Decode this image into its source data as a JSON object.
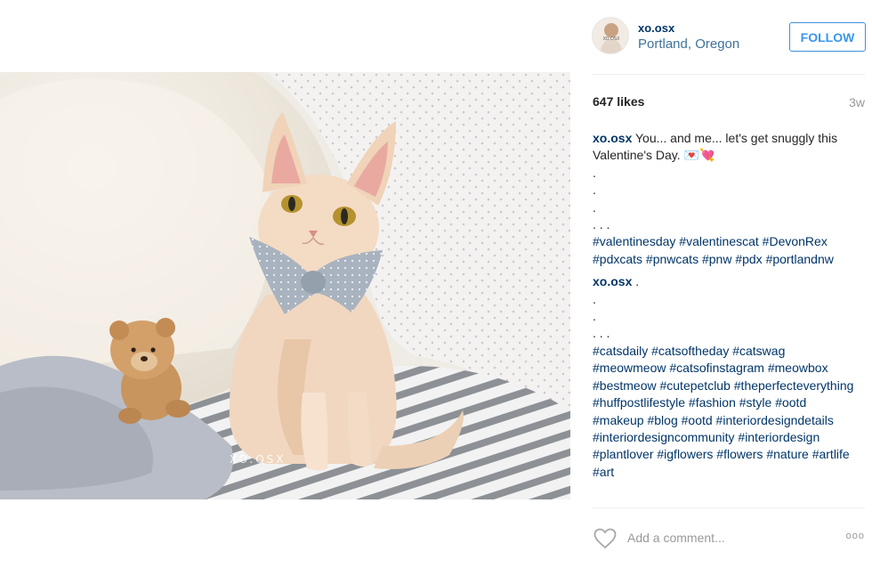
{
  "post": {
    "watermark": "XO.OSX",
    "photo_subject": "cat-photo"
  },
  "header": {
    "username": "xo.osx",
    "location": "Portland, Oregon",
    "follow_label": "FOLLOW",
    "avatar_text": "XO.OSX"
  },
  "stats": {
    "likes": "647 likes",
    "age": "3w"
  },
  "comments": [
    {
      "user": "xo.osx",
      "text": " You... and me... let's get snuggly this Valentine's Day. 💌💘",
      "dots": [
        ".",
        ".",
        ".",
        ". . ."
      ],
      "tags": "#valentinesday #valentinescat #DevonRex #pdxcats #pnwcats #pnw #pdx #portlandnw"
    },
    {
      "user": "xo.osx",
      "text": " .",
      "dots": [
        ".",
        ".",
        ". . ."
      ],
      "tags": "#catsdaily #catsoftheday #catswag #meowmeow #catsofinstagram #meowbox #bestmeow #cutepetclub #theperfecteverything #huffpostlifestyle #fashion #style #ootd #makeup #blog #ootd #interiordesigndetails #interiordesigncommunity #interiordesign #plantlover #igflowers #flowers #nature #artlife #art"
    }
  ],
  "add_comment": {
    "placeholder": "Add a comment...",
    "more_label": "ooo"
  },
  "colors": {
    "link": "#003569",
    "location": "#3f729b",
    "follow": "#3897f0",
    "muted": "#999999"
  }
}
